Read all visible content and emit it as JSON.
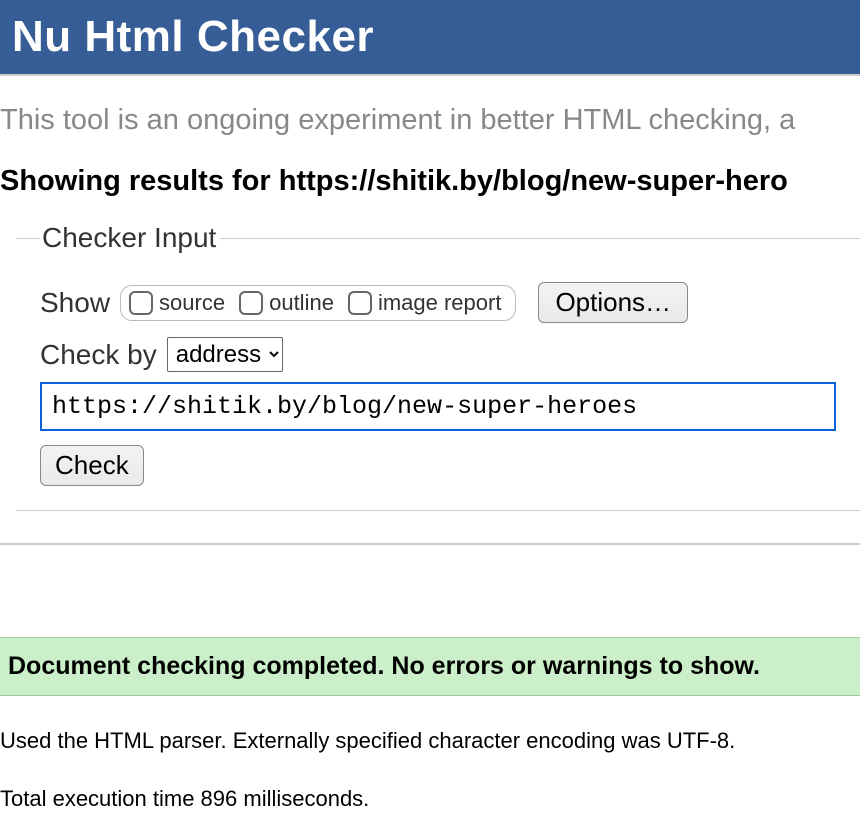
{
  "header": {
    "title": "Nu Html Checker"
  },
  "intro": "This tool is an ongoing experiment in better HTML checking, a",
  "results_for": "Showing results for https://shitik.by/blog/new-super-hero",
  "form": {
    "legend": "Checker Input",
    "show_label": "Show",
    "checkboxes": {
      "source": "source",
      "outline": "outline",
      "image_report": "image report"
    },
    "options_button": "Options…",
    "check_by_label": "Check by",
    "check_by_selected": "address",
    "url_value": "https://shitik.by/blog/new-super-heroes",
    "check_button": "Check"
  },
  "success_message": "Document checking completed. No errors or warnings to show.",
  "parser_line": "Used the HTML parser. Externally specified character encoding was UTF-8.",
  "time_line": "Total execution time 896 milliseconds."
}
